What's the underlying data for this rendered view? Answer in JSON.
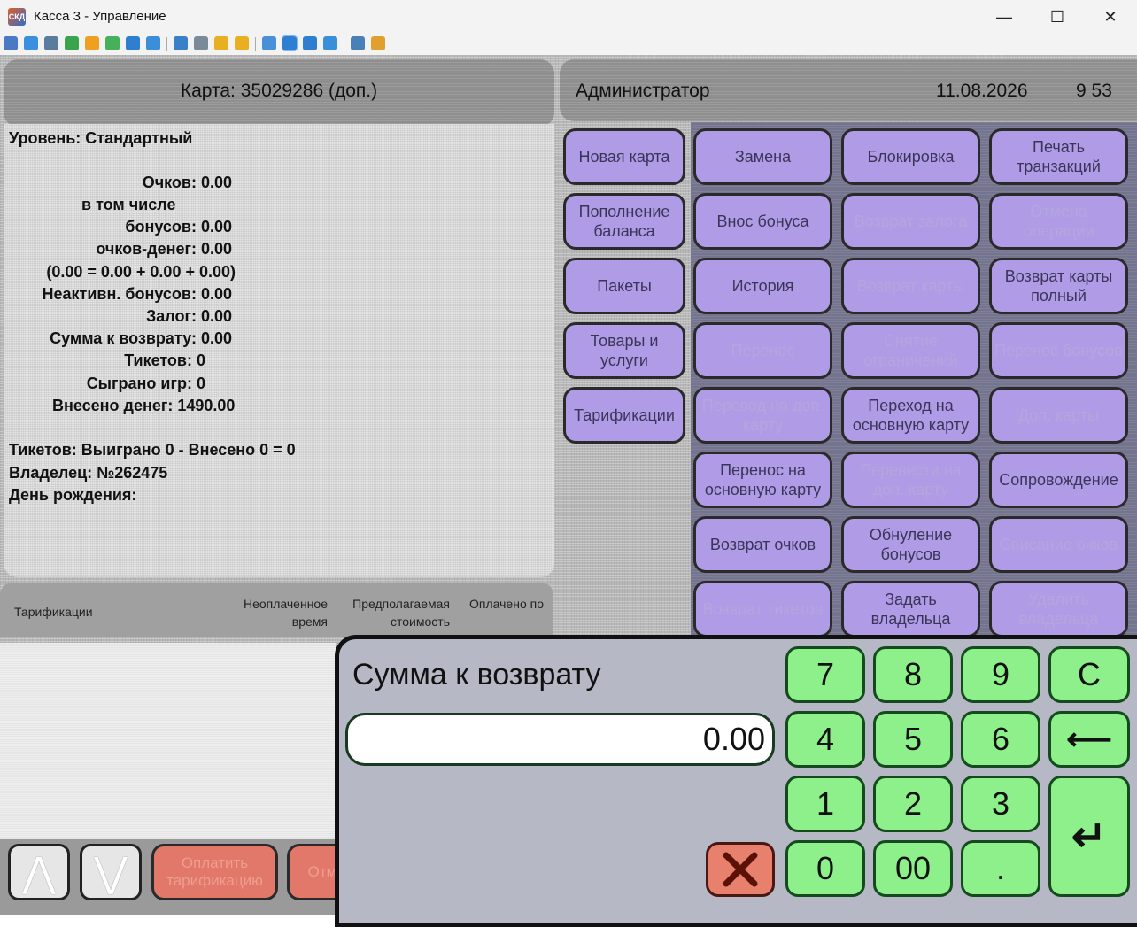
{
  "window": {
    "title": "Касса 3 - Управление",
    "app_icon_label": "СКД",
    "minimize_glyph": "—",
    "maximize_glyph": "☐",
    "close_glyph": "✕"
  },
  "toolbar": {
    "icons": [
      "monitor-icon",
      "screen-icon",
      "terminal-icon",
      "sync-icon",
      "clock-icon",
      "chat-icon",
      "phone-icon",
      "message-icon",
      "upload-icon",
      "network-icon",
      "lock-icon",
      "lock-open-icon",
      "window-icon",
      "fullscreen-icon",
      "square-icon",
      "expand-icon",
      "copy-icon",
      "tools-icon"
    ]
  },
  "header": {
    "card": "Карта: 35029286 (доп.)",
    "user": "Администратор",
    "date": "11.08.2026",
    "time": "9 53"
  },
  "card_info": {
    "level": "Уровень: Стандартный",
    "points": "Очков: 0.00",
    "including": "в том числе",
    "bonuses": "бонусов: 0.00",
    "money_points": "очков-денег: 0.00",
    "formula": "(0.00 = 0.00 + 0.00 + 0.00)",
    "inactive_bonuses": "Неактивн. бонусов: 0.00",
    "deposit": "Залог: 0.00",
    "refund_sum": "Сумма к возврату: 0.00",
    "tickets": "Тикетов: 0",
    "games_played": "Сыграно игр: 0",
    "money_deposited": "Внесено денег: 1490.00",
    "tickets_summary": "Тикетов: Выиграно 0 - Внесено 0 = 0",
    "owner": "Владелец: №262475",
    "birthday": "День рождения:"
  },
  "left_menu": [
    "Новая карта",
    "Пополнение баланса",
    "Пакеты",
    "Товары и услуги",
    "Тарификации"
  ],
  "action_buttons": [
    {
      "label": "Замена",
      "enabled": true
    },
    {
      "label": "Блокировка",
      "enabled": true
    },
    {
      "label": "Печать транзакций",
      "enabled": true
    },
    {
      "label": "Внос бонуса",
      "enabled": true
    },
    {
      "label": "Возврат залога",
      "enabled": false
    },
    {
      "label": "Отмена операции",
      "enabled": false
    },
    {
      "label": "История",
      "enabled": true
    },
    {
      "label": "Возврат карты",
      "enabled": false
    },
    {
      "label": "Возврат карты полный",
      "enabled": true
    },
    {
      "label": "Перенос",
      "enabled": false
    },
    {
      "label": "Снятие ограничений",
      "enabled": false
    },
    {
      "label": "Перенос бонусов",
      "enabled": false
    },
    {
      "label": "Перевод на доп. карту",
      "enabled": false
    },
    {
      "label": "Переход на основную карту",
      "enabled": true
    },
    {
      "label": "Доп. карты",
      "enabled": false
    },
    {
      "label": "Перенос на основную карту",
      "enabled": true
    },
    {
      "label": "Перевести на доп. карту",
      "enabled": false
    },
    {
      "label": "Сопровождение",
      "enabled": true
    },
    {
      "label": "Возврат очков",
      "enabled": true
    },
    {
      "label": "Обнуление бонусов",
      "enabled": true
    },
    {
      "label": "Списание очков",
      "enabled": false
    },
    {
      "label": "Возврат тикетов",
      "enabled": false
    },
    {
      "label": "Задать владельца",
      "enabled": true
    },
    {
      "label": "Удалить владельца",
      "enabled": false
    }
  ],
  "tarif_table": {
    "col1": "Тарификации",
    "col2": "Неоплаченное время",
    "col3": "Предполагаемая стоимость",
    "col4": "Оплачено по"
  },
  "bottom": {
    "up_glyph": "⋀",
    "down_glyph": "⋁",
    "btn1": "Оплатить тарификацию",
    "btn2": "Отм"
  },
  "dialog": {
    "title": "Сумма к возврату",
    "value": "0.00",
    "keys": {
      "k7": "7",
      "k8": "8",
      "k9": "9",
      "clear": "C",
      "k4": "4",
      "k5": "5",
      "k6": "6",
      "backspace": "⟵",
      "k1": "1",
      "k2": "2",
      "k3": "3",
      "enter": "↵",
      "k0": "0",
      "k00": "00",
      "dot": "."
    }
  },
  "colors": {
    "purple_button": "#b09ce6",
    "green_key": "#8ef08a",
    "red_button": "#e1786a",
    "grid_bg": "#74748e"
  }
}
